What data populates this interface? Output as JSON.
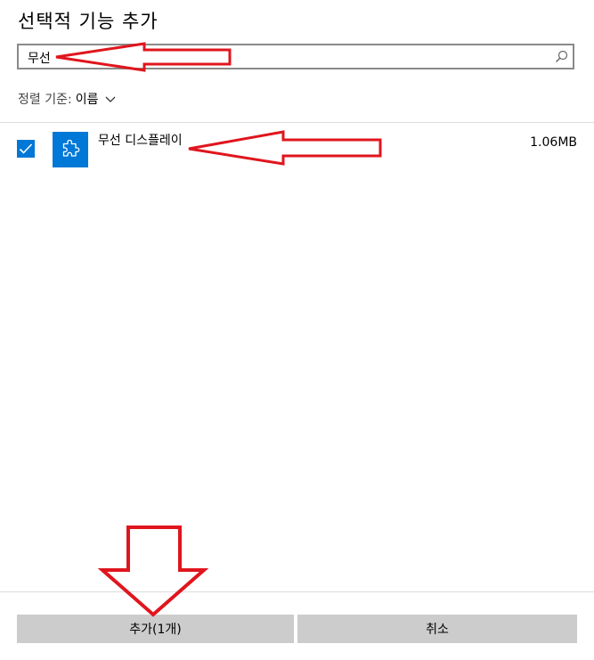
{
  "dialog": {
    "title": "선택적 기능 추가"
  },
  "search": {
    "value": "무선",
    "icon": "search-icon"
  },
  "sort": {
    "label": "정렬 기준:",
    "value": "이름",
    "icon": "chevron-down-icon"
  },
  "features": [
    {
      "name": "무선 디스플레이",
      "size": "1.06MB",
      "checked": true,
      "icon": "puzzle-icon"
    }
  ],
  "buttons": {
    "add_label": "추가(1개)",
    "cancel_label": "취소"
  },
  "colors": {
    "accent": "#0078d7",
    "annotation": "#e0151d",
    "button_bg": "#cccccc"
  }
}
